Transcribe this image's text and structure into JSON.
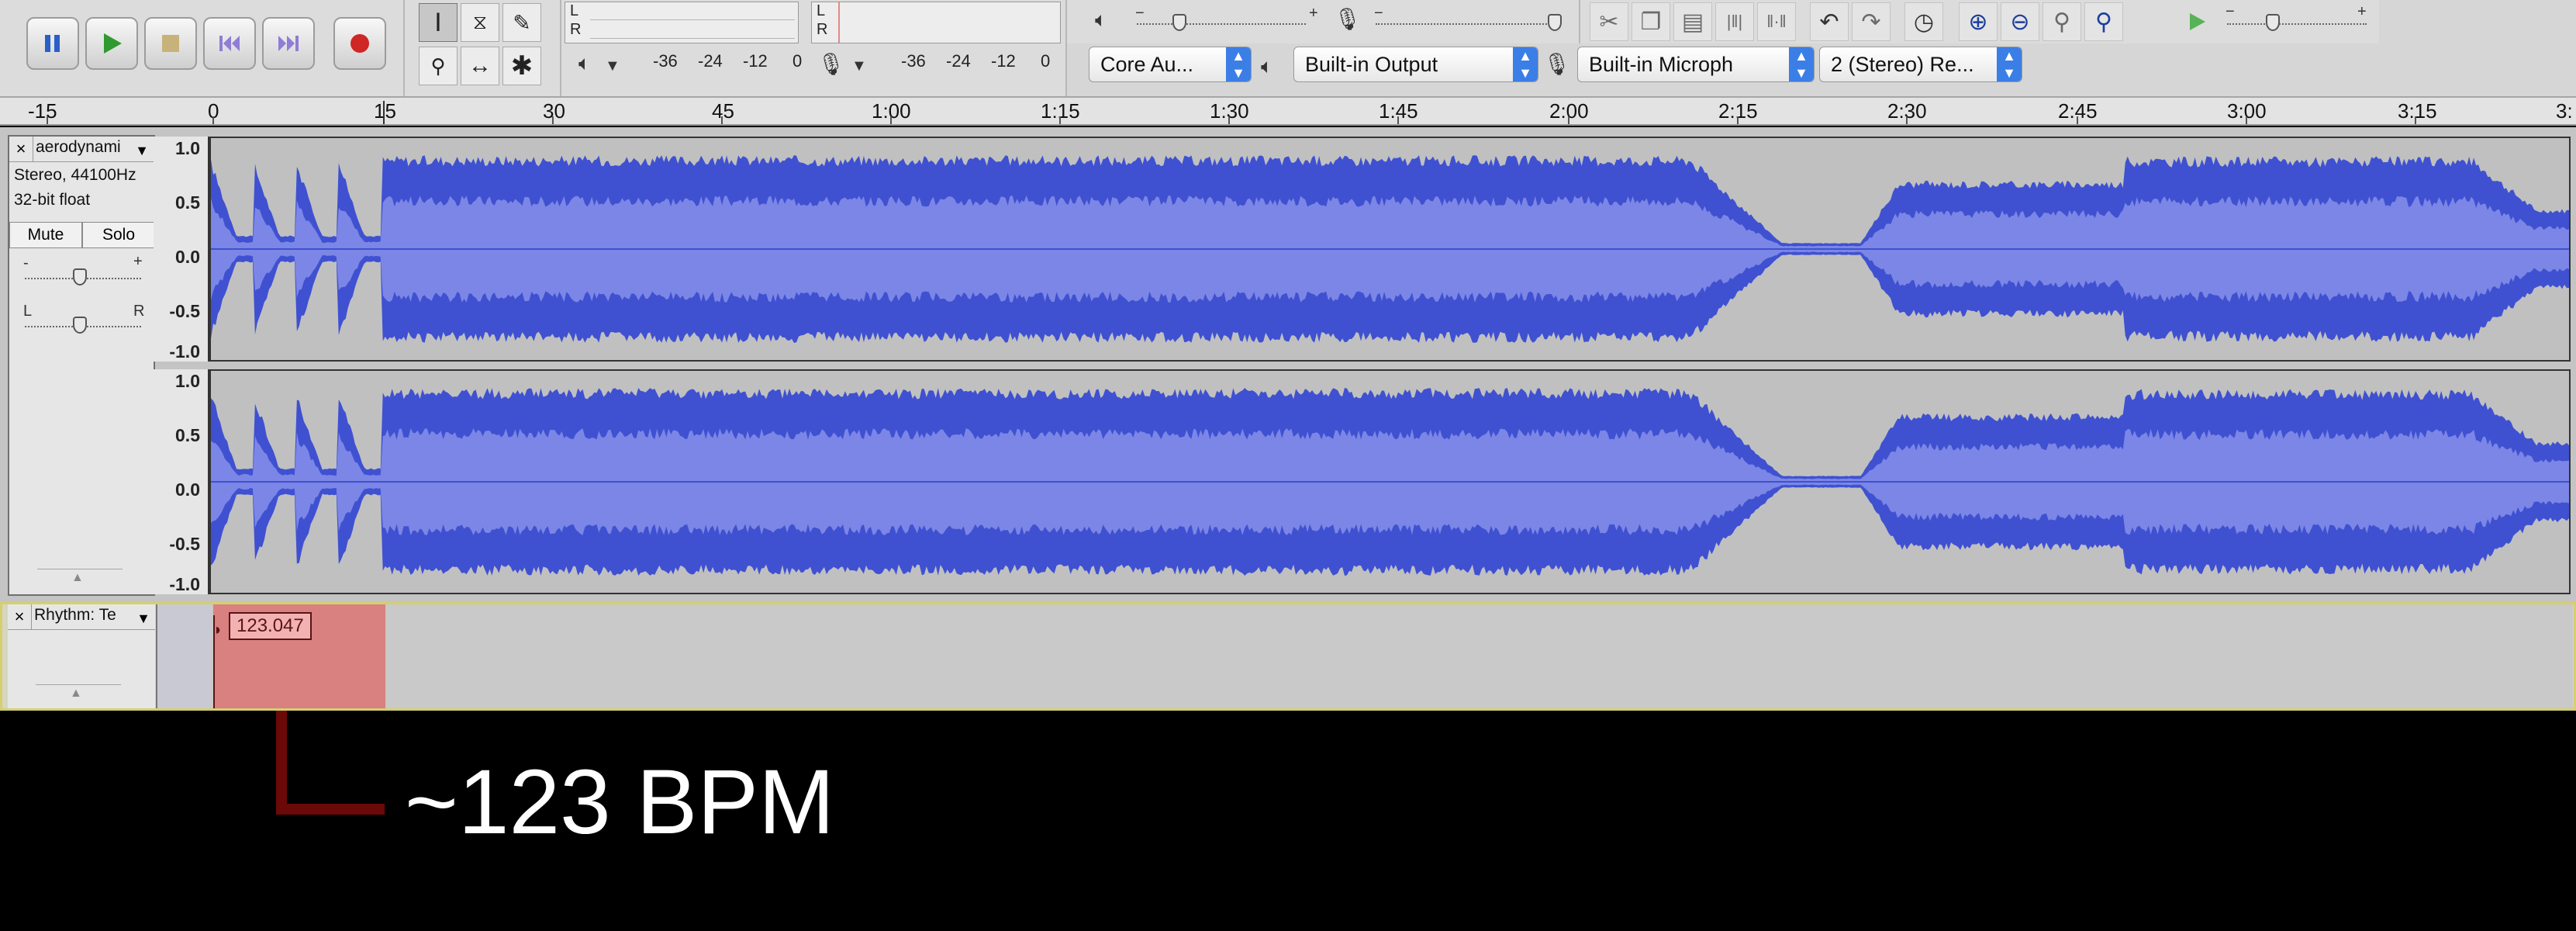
{
  "transport": {
    "pause_icon": "pause-icon",
    "play_icon": "play-icon",
    "stop_icon": "stop-icon",
    "skip_start_icon": "skip-to-start-icon",
    "skip_end_icon": "skip-to-end-icon",
    "record_icon": "record-icon"
  },
  "meters": {
    "playback_l": "L",
    "playback_r": "R",
    "record_l": "L",
    "record_r": "R",
    "playback_scale": [
      "-36",
      "-24",
      "-12",
      "0"
    ],
    "record_scale": [
      "-36",
      "-24",
      "-12",
      "0"
    ]
  },
  "mixer": {
    "minus": "−",
    "plus": "+"
  },
  "device": {
    "host": "Core Au...",
    "output": "Built-in Output",
    "input": "Built-in Microph",
    "channels": "2 (Stereo) Re..."
  },
  "ruler": {
    "labels": [
      "-15",
      "0",
      "15",
      "30",
      "45",
      "1:00",
      "1:15",
      "1:30",
      "1:45",
      "2:00",
      "2:15",
      "2:30",
      "2:45",
      "3:00",
      "3:15",
      "3:"
    ]
  },
  "audio_track": {
    "close": "×",
    "name": "aerodynami",
    "format": "Stereo, 44100Hz",
    "bitdepth": "32-bit float",
    "mute": "Mute",
    "solo": "Solo",
    "gain_minus": "-",
    "gain_plus": "+",
    "pan_l": "L",
    "pan_r": "R",
    "scale": [
      "1.0",
      "0.5",
      "0.0",
      "-0.5",
      "-1.0"
    ]
  },
  "label_track": {
    "close": "×",
    "name": "Rhythm: Te",
    "bpm_label": "123.047"
  },
  "annotation": {
    "text": "~123 BPM"
  },
  "colors": {
    "wave_dark": "#3f51d1",
    "wave_light": "#7b86e6",
    "label_region": "#d98080"
  }
}
